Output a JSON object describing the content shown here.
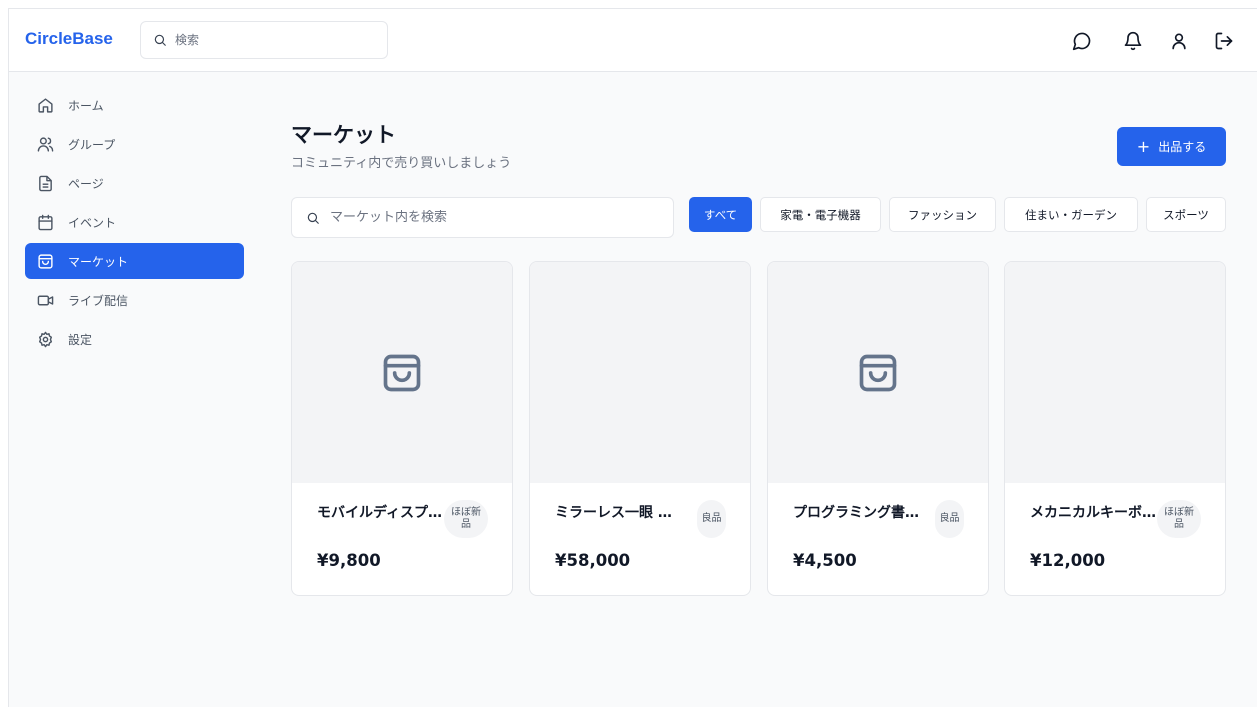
{
  "app": {
    "logo": "CircleBase"
  },
  "header": {
    "search_placeholder": "検索",
    "icons": [
      "chat-icon",
      "bell-icon",
      "user-icon",
      "logout-icon"
    ]
  },
  "sidebar": {
    "items": [
      {
        "label": "ホーム",
        "icon": "home-icon",
        "active": false
      },
      {
        "label": "グループ",
        "icon": "users-icon",
        "active": false
      },
      {
        "label": "ページ",
        "icon": "file-icon",
        "active": false
      },
      {
        "label": "イベント",
        "icon": "calendar-icon",
        "active": false
      },
      {
        "label": "マーケット",
        "icon": "shopping-bag-icon",
        "active": true
      },
      {
        "label": "ライブ配信",
        "icon": "video-icon",
        "active": false
      },
      {
        "label": "設定",
        "icon": "gear-icon",
        "active": false
      }
    ]
  },
  "main": {
    "title": "マーケット",
    "subtitle": "コミュニティ内で売り買いしましょう",
    "sell_button": {
      "plus": "+",
      "label": "出品する"
    },
    "search_placeholder": "マーケット内を検索",
    "filters": [
      {
        "label": "すべて",
        "active": true
      },
      {
        "label": "家電・電子機器",
        "active": false
      },
      {
        "label": "ファッション",
        "active": false
      },
      {
        "label": "住まい・ガーデン",
        "active": false
      },
      {
        "label": "スポーツ",
        "active": false
      }
    ],
    "products": [
      {
        "name": "モバイルディスプレイ",
        "condition": "ほぼ新品",
        "price": "¥9,800",
        "has_icon": true
      },
      {
        "name": "ミラーレス一眼 レンズキット",
        "condition": "良品",
        "price": "¥58,000",
        "has_icon": false
      },
      {
        "name": "プログラミング書籍セット",
        "condition": "良品",
        "price": "¥4,500",
        "has_icon": true
      },
      {
        "name": "メカニカルキーボード",
        "condition": "ほぼ新品",
        "price": "¥12,000",
        "has_icon": false
      }
    ]
  },
  "colors": {
    "accent": "#2563eb",
    "text": "#111827",
    "muted": "#6b7280",
    "border": "#e5e7eb",
    "placeholder_bg": "#f3f4f6",
    "icon": "#64748b"
  }
}
